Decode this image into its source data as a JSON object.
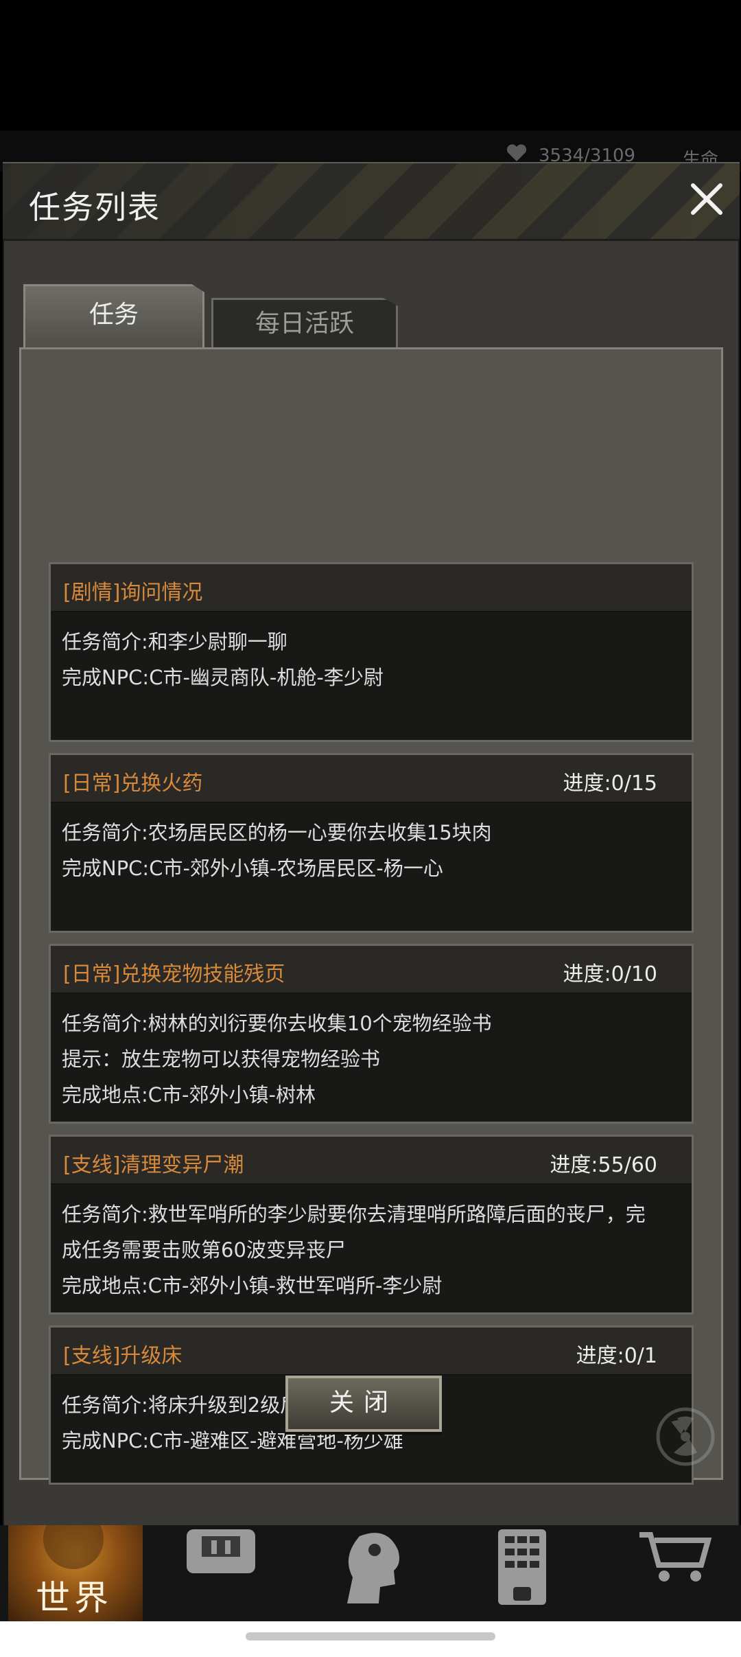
{
  "hud": {
    "stat_text": "3534/3109",
    "right_label": "生命"
  },
  "modal": {
    "title": "任务列表",
    "tabs": [
      {
        "label": "任务",
        "active": true
      },
      {
        "label": "每日活跃",
        "active": false
      }
    ],
    "tasks": [
      {
        "title": "[剧情]询问情况",
        "progress": "",
        "lines": [
          "任务简介:和李少尉聊一聊",
          "完成NPC:C市-幽灵商队-机舱-李少尉"
        ]
      },
      {
        "title": "[日常]兑换火药",
        "progress": "进度:0/15",
        "lines": [
          "任务简介:农场居民区的杨一心要你去收集15块肉",
          "完成NPC:C市-郊外小镇-农场居民区-杨一心"
        ]
      },
      {
        "title": "[日常]兑换宠物技能残页",
        "progress": "进度:0/10",
        "lines": [
          "任务简介:树林的刘衍要你去收集10个宠物经验书",
          "提示：放生宠物可以获得宠物经验书",
          "完成地点:C市-郊外小镇-树林"
        ]
      },
      {
        "title": "[支线]清理变异尸潮",
        "progress": "进度:55/60",
        "lines": [
          "任务简介:救世军哨所的李少尉要你去清理哨所路障后面的丧尸，完",
          "成任务需要击败第60波变异丧尸",
          "完成地点:C市-郊外小镇-救世军哨所-李少尉"
        ]
      },
      {
        "title": "[支线]升级床",
        "progress": "进度:0/1",
        "lines": [
          "任务简介:将床升级到2级后，再去找杨少雄",
          "完成NPC:C市-避难区-避难营地-杨少雄"
        ]
      }
    ],
    "close_button": "关闭"
  },
  "bottom_nav": {
    "world_label": "世界",
    "items": [
      "world-icon",
      "backpack-icon",
      "head-icon",
      "building-icon",
      "cart-icon"
    ]
  },
  "colors": {
    "task_title": "#d8893a",
    "panel": "#55544f",
    "card": "#181816"
  }
}
